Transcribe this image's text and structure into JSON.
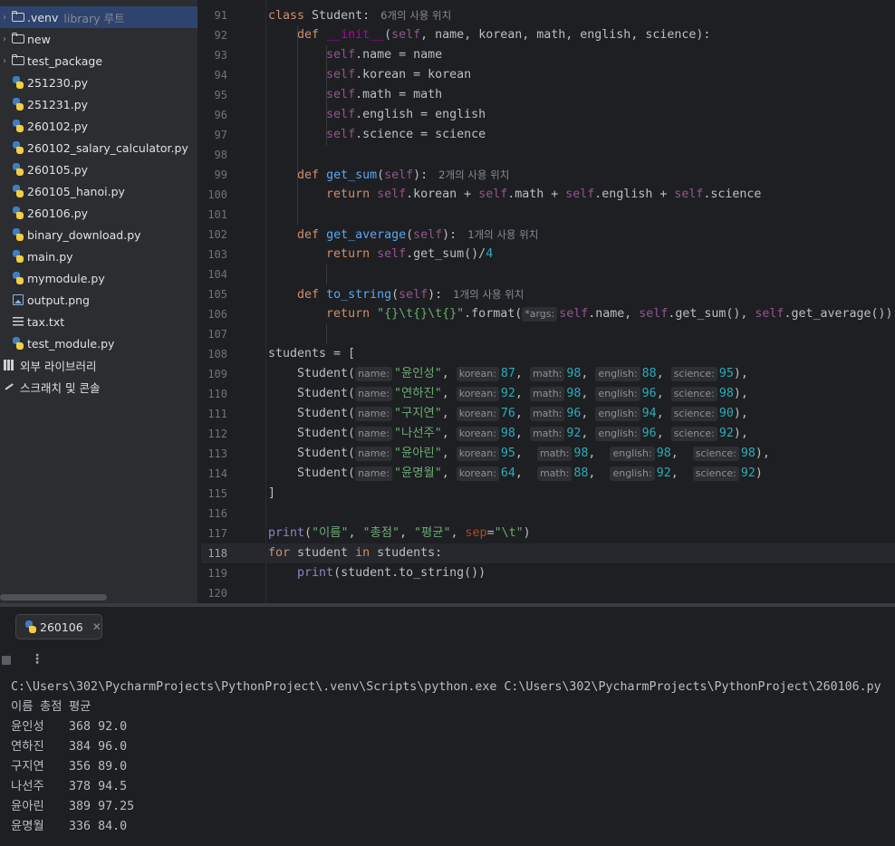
{
  "sidebar": {
    "items": [
      {
        "label": ".venv",
        "suffix": "library 루트",
        "icon": "folder-icon",
        "kind": "folder",
        "expandable": true
      },
      {
        "label": "new",
        "icon": "folder-icon",
        "kind": "folder",
        "expandable": true
      },
      {
        "label": "test_package",
        "icon": "package-folder-icon",
        "kind": "folder",
        "expandable": true
      },
      {
        "label": "251230.py",
        "icon": "python-file-icon",
        "kind": "py"
      },
      {
        "label": "251231.py",
        "icon": "python-file-icon",
        "kind": "py"
      },
      {
        "label": "260102.py",
        "icon": "python-file-icon",
        "kind": "py"
      },
      {
        "label": "260102_salary_calculator.py",
        "icon": "python-file-icon",
        "kind": "py"
      },
      {
        "label": "260105.py",
        "icon": "python-file-icon",
        "kind": "py"
      },
      {
        "label": "260105_hanoi.py",
        "icon": "python-file-icon",
        "kind": "py"
      },
      {
        "label": "260106.py",
        "icon": "python-file-icon",
        "kind": "py"
      },
      {
        "label": "binary_download.py",
        "icon": "python-file-icon",
        "kind": "py"
      },
      {
        "label": "main.py",
        "icon": "python-file-icon",
        "kind": "py"
      },
      {
        "label": "mymodule.py",
        "icon": "python-file-icon",
        "kind": "py"
      },
      {
        "label": "output.png",
        "icon": "image-file-icon",
        "kind": "img"
      },
      {
        "label": "tax.txt",
        "icon": "text-file-icon",
        "kind": "txt"
      },
      {
        "label": "test_module.py",
        "icon": "python-file-icon",
        "kind": "py"
      },
      {
        "label": "외부 라이브러리",
        "icon": "external-libraries-icon",
        "kind": "libs",
        "expandable": true
      },
      {
        "label": "스크래치 및 콘솔",
        "icon": "scratches-icon",
        "kind": "scratch"
      }
    ]
  },
  "editor": {
    "current_line": 118,
    "lines": [
      {
        "n": 91,
        "tokens": [
          [
            "kw",
            "class "
          ],
          [
            "",
            "Student:"
          ]
        ],
        "usage": "6개의 사용 위치"
      },
      {
        "n": 92,
        "tokens": [
          [
            "",
            "    "
          ],
          [
            "kw",
            "def "
          ],
          [
            "mg",
            "__init__"
          ],
          [
            "",
            "("
          ],
          [
            "sf",
            "self"
          ],
          [
            "",
            ", name, korean, math, english, science):"
          ]
        ]
      },
      {
        "n": 93,
        "tokens": [
          [
            "",
            "        "
          ],
          [
            "sf",
            "self"
          ],
          [
            "",
            ".name = name"
          ]
        ]
      },
      {
        "n": 94,
        "tokens": [
          [
            "",
            "        "
          ],
          [
            "sf",
            "self"
          ],
          [
            "",
            ".korean = korean"
          ]
        ]
      },
      {
        "n": 95,
        "tokens": [
          [
            "",
            "        "
          ],
          [
            "sf",
            "self"
          ],
          [
            "",
            ".math = math"
          ]
        ]
      },
      {
        "n": 96,
        "tokens": [
          [
            "",
            "        "
          ],
          [
            "sf",
            "self"
          ],
          [
            "",
            ".english = english"
          ]
        ]
      },
      {
        "n": 97,
        "tokens": [
          [
            "",
            "        "
          ],
          [
            "sf",
            "self"
          ],
          [
            "",
            ".science = science"
          ]
        ]
      },
      {
        "n": 98,
        "tokens": []
      },
      {
        "n": 99,
        "tokens": [
          [
            "",
            "    "
          ],
          [
            "kw",
            "def "
          ],
          [
            "fn",
            "get_sum"
          ],
          [
            "",
            "("
          ],
          [
            "sf",
            "self"
          ],
          [
            "",
            "):"
          ]
        ],
        "usage": "2개의 사용 위치"
      },
      {
        "n": 100,
        "tokens": [
          [
            "",
            "        "
          ],
          [
            "kw",
            "return "
          ],
          [
            "sf",
            "self"
          ],
          [
            "",
            ".korean + "
          ],
          [
            "sf",
            "self"
          ],
          [
            "",
            ".math + "
          ],
          [
            "sf",
            "self"
          ],
          [
            "",
            ".english + "
          ],
          [
            "sf",
            "self"
          ],
          [
            "",
            ".science"
          ]
        ]
      },
      {
        "n": 101,
        "tokens": []
      },
      {
        "n": 102,
        "tokens": [
          [
            "",
            "    "
          ],
          [
            "kw",
            "def "
          ],
          [
            "fn",
            "get_average"
          ],
          [
            "",
            "("
          ],
          [
            "sf",
            "self"
          ],
          [
            "",
            "):"
          ]
        ],
        "usage": "1개의 사용 위치"
      },
      {
        "n": 103,
        "tokens": [
          [
            "",
            "        "
          ],
          [
            "kw",
            "return "
          ],
          [
            "sf",
            "self"
          ],
          [
            "",
            ".get_sum()/"
          ],
          [
            "num",
            "4"
          ]
        ]
      },
      {
        "n": 104,
        "tokens": []
      },
      {
        "n": 105,
        "tokens": [
          [
            "",
            "    "
          ],
          [
            "kw",
            "def "
          ],
          [
            "fn",
            "to_string"
          ],
          [
            "",
            "("
          ],
          [
            "sf",
            "self"
          ],
          [
            "",
            "):"
          ]
        ],
        "usage": "1개의 사용 위치"
      },
      {
        "n": 106,
        "tokens": [
          [
            "",
            "        "
          ],
          [
            "kw",
            "return "
          ],
          [
            "str",
            "\"{}\\t{}\\t{}\""
          ],
          [
            "",
            ".format("
          ],
          [
            "hint",
            "*args:"
          ],
          [
            "sf",
            "self"
          ],
          [
            "",
            ".name, "
          ],
          [
            "sf",
            "self"
          ],
          [
            "",
            ".get_sum(), "
          ],
          [
            "sf",
            "self"
          ],
          [
            "",
            ".get_average())"
          ]
        ]
      },
      {
        "n": 107,
        "tokens": []
      },
      {
        "n": 108,
        "tokens": [
          [
            "",
            "students = ["
          ]
        ]
      },
      {
        "n": 109,
        "tokens": [
          [
            "",
            "    Student("
          ],
          [
            "hint",
            "name:"
          ],
          [
            "str",
            "\"윤인성\""
          ],
          [
            "",
            ", "
          ],
          [
            "hint",
            "korean:"
          ],
          [
            "num",
            "87"
          ],
          [
            "",
            ", "
          ],
          [
            "hint",
            "math:"
          ],
          [
            "num",
            "98"
          ],
          [
            "",
            ", "
          ],
          [
            "hint",
            "english:"
          ],
          [
            "num",
            "88"
          ],
          [
            "",
            ", "
          ],
          [
            "hint",
            "science:"
          ],
          [
            "num",
            "95"
          ],
          [
            "",
            "),"
          ]
        ]
      },
      {
        "n": 110,
        "tokens": [
          [
            "",
            "    Student("
          ],
          [
            "hint",
            "name:"
          ],
          [
            "str",
            "\"연하진\""
          ],
          [
            "",
            ", "
          ],
          [
            "hint",
            "korean:"
          ],
          [
            "num",
            "92"
          ],
          [
            "",
            ", "
          ],
          [
            "hint",
            "math:"
          ],
          [
            "num",
            "98"
          ],
          [
            "",
            ", "
          ],
          [
            "hint",
            "english:"
          ],
          [
            "num",
            "96"
          ],
          [
            "",
            ", "
          ],
          [
            "hint",
            "science:"
          ],
          [
            "num",
            "98"
          ],
          [
            "",
            "),"
          ]
        ]
      },
      {
        "n": 111,
        "tokens": [
          [
            "",
            "    Student("
          ],
          [
            "hint",
            "name:"
          ],
          [
            "str",
            "\"구지연\""
          ],
          [
            "",
            ", "
          ],
          [
            "hint",
            "korean:"
          ],
          [
            "num",
            "76"
          ],
          [
            "",
            ", "
          ],
          [
            "hint",
            "math:"
          ],
          [
            "num",
            "96"
          ],
          [
            "",
            ", "
          ],
          [
            "hint",
            "english:"
          ],
          [
            "num",
            "94"
          ],
          [
            "",
            ", "
          ],
          [
            "hint",
            "science:"
          ],
          [
            "num",
            "90"
          ],
          [
            "",
            "),"
          ]
        ]
      },
      {
        "n": 112,
        "tokens": [
          [
            "",
            "    Student("
          ],
          [
            "hint",
            "name:"
          ],
          [
            "str",
            "\"나선주\""
          ],
          [
            "",
            ", "
          ],
          [
            "hint",
            "korean:"
          ],
          [
            "num",
            "98"
          ],
          [
            "",
            ", "
          ],
          [
            "hint",
            "math:"
          ],
          [
            "num",
            "92"
          ],
          [
            "",
            ", "
          ],
          [
            "hint",
            "english:"
          ],
          [
            "num",
            "96"
          ],
          [
            "",
            ", "
          ],
          [
            "hint",
            "science:"
          ],
          [
            "num",
            "92"
          ],
          [
            "",
            "),"
          ]
        ]
      },
      {
        "n": 113,
        "tokens": [
          [
            "",
            "    Student("
          ],
          [
            "hint",
            "name:"
          ],
          [
            "str",
            "\"윤아린\""
          ],
          [
            "",
            ", "
          ],
          [
            "hint",
            "korean:"
          ],
          [
            "num",
            "95"
          ],
          [
            "",
            ",  "
          ],
          [
            "hint",
            "math:"
          ],
          [
            "num",
            "98"
          ],
          [
            "",
            ",  "
          ],
          [
            "hint",
            "english:"
          ],
          [
            "num",
            "98"
          ],
          [
            "",
            ",  "
          ],
          [
            "hint",
            "science:"
          ],
          [
            "num",
            "98"
          ],
          [
            "",
            "),"
          ]
        ]
      },
      {
        "n": 114,
        "tokens": [
          [
            "",
            "    Student("
          ],
          [
            "hint",
            "name:"
          ],
          [
            "str",
            "\"윤명월\""
          ],
          [
            "",
            ", "
          ],
          [
            "hint",
            "korean:"
          ],
          [
            "num",
            "64"
          ],
          [
            "",
            ",  "
          ],
          [
            "hint",
            "math:"
          ],
          [
            "num",
            "88"
          ],
          [
            "",
            ",  "
          ],
          [
            "hint",
            "english:"
          ],
          [
            "num",
            "92"
          ],
          [
            "",
            ",  "
          ],
          [
            "hint",
            "science:"
          ],
          [
            "num",
            "92"
          ],
          [
            "",
            ")"
          ]
        ]
      },
      {
        "n": 115,
        "tokens": [
          [
            "",
            "]"
          ]
        ]
      },
      {
        "n": 116,
        "tokens": []
      },
      {
        "n": 117,
        "tokens": [
          [
            "bi",
            "print"
          ],
          [
            "",
            "("
          ],
          [
            "str",
            "\"이름\""
          ],
          [
            "",
            ", "
          ],
          [
            "str",
            "\"총점\""
          ],
          [
            "",
            ", "
          ],
          [
            "str",
            "\"평균\""
          ],
          [
            "",
            ", "
          ],
          [
            "pr",
            "sep"
          ],
          [
            "",
            "="
          ],
          [
            "str",
            "\"\\t\""
          ],
          [
            "",
            ")"
          ]
        ]
      },
      {
        "n": 118,
        "tokens": [
          [
            "kw",
            "for "
          ],
          [
            "",
            "student "
          ],
          [
            "kw",
            "in "
          ],
          [
            "",
            "students:"
          ]
        ]
      },
      {
        "n": 119,
        "tokens": [
          [
            "",
            "    "
          ],
          [
            "bi",
            "print"
          ],
          [
            "",
            "(student.to_string())"
          ]
        ]
      },
      {
        "n": 120,
        "tokens": []
      }
    ]
  },
  "run_panel": {
    "tab_label": "260106",
    "tab_icon": "python-file-icon",
    "close_icon": "close-icon",
    "stop_icon": "stop-icon",
    "more_icon": "more-vertical-icon",
    "console_lines": [
      "C:\\Users\\302\\PycharmProjects\\PythonProject\\.venv\\Scripts\\python.exe C:\\Users\\302\\PycharmProjects\\PythonProject\\260106.py",
      "이름\t총점\t평균",
      "윤인성\t368\t92.0",
      "연하진\t384\t96.0",
      "구지연\t356\t89.0",
      "나선주\t378\t94.5",
      "윤아린\t389\t97.25",
      "윤명월\t336\t84.0"
    ]
  },
  "colors": {
    "background": "#1e1f22",
    "sidebar": "#2b2d30",
    "keyword": "#cf8e6d",
    "function": "#56a8f5",
    "self": "#94558d",
    "string": "#6aab73",
    "number": "#2aacb8"
  }
}
